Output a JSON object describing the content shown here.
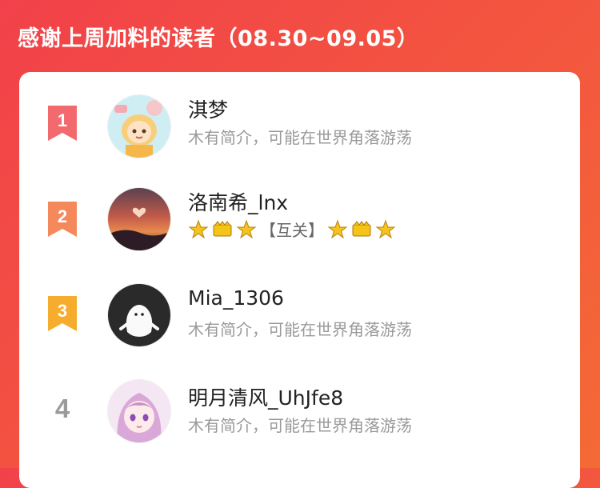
{
  "header": {
    "title": "感谢上周加料的读者（08.30~09.05）"
  },
  "colors": {
    "rank1": "#f36a6e",
    "rank2": "#f5895c",
    "rank3": "#f6ad2e",
    "rank_other": "#9a9a9a"
  },
  "readers": [
    {
      "rank": "1",
      "name": "淇梦",
      "desc": "木有简介，可能在世界角落游荡",
      "avatar": "anime-girl-avatar"
    },
    {
      "rank": "2",
      "name": "洛南希_lnx",
      "desc": "【互关】",
      "avatar": "sunset-heart-avatar",
      "badge_icons": [
        "star-icon",
        "crown-icon",
        "star-icon",
        "star-icon",
        "crown-icon",
        "star-icon"
      ]
    },
    {
      "rank": "3",
      "name": "Mia_1306",
      "desc": "木有简介，可能在世界角落游荡",
      "avatar": "ghost-avatar"
    },
    {
      "rank": "4",
      "name": "明月清风_UhJfe8",
      "desc": "木有简介，可能在世界角落游荡",
      "avatar": "pink-hair-girl-avatar"
    }
  ]
}
